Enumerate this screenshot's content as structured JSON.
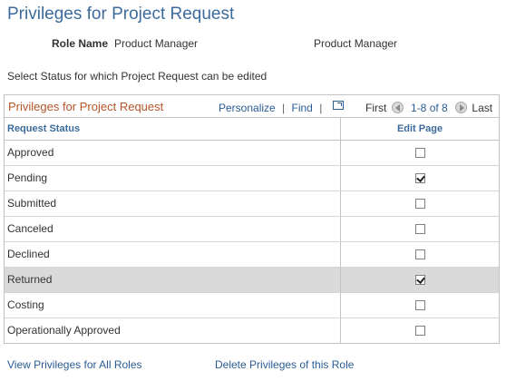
{
  "page": {
    "title": "Privileges for Project Request",
    "role_name_label": "Role Name",
    "role_name_value": "Product Manager",
    "role_description": "Product Manager",
    "instructions": "Select Status for which Project Request can be edited"
  },
  "grid": {
    "title": "Privileges for Project Request",
    "personalize": "Personalize",
    "find": "Find",
    "first": "First",
    "range": "1-8 of 8",
    "last": "Last",
    "columns": [
      "Request Status",
      "Edit Page"
    ],
    "rows": [
      {
        "status": "Approved",
        "edit": false
      },
      {
        "status": "Pending",
        "edit": true
      },
      {
        "status": "Submitted",
        "edit": false
      },
      {
        "status": "Canceled",
        "edit": false
      },
      {
        "status": "Declined",
        "edit": false
      },
      {
        "status": "Returned",
        "edit": true
      },
      {
        "status": "Costing",
        "edit": false
      },
      {
        "status": "Operationally Approved",
        "edit": false
      }
    ]
  },
  "footer": {
    "view_all": "View Privileges for All Roles",
    "delete": "Delete Privileges of this Role"
  },
  "colors": {
    "title": "#3c6b9c",
    "link": "#2a5d96",
    "grid_title": "#b5552a",
    "highlight_row": "#dadada"
  },
  "icons": [
    "zoom-icon",
    "previous-icon",
    "next-icon",
    "checkbox-checked",
    "checkbox-unchecked"
  ]
}
